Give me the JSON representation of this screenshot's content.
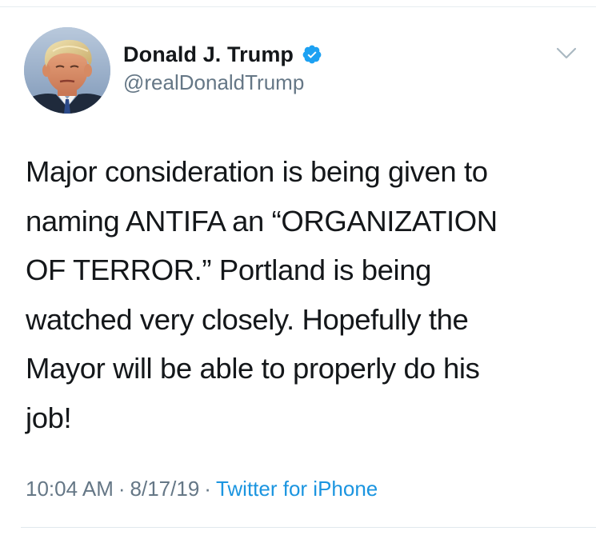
{
  "tweet": {
    "author": {
      "display_name": "Donald J. Trump",
      "handle": "@realDonaldTrump",
      "verified": true,
      "avatar_icon": "profile-photo"
    },
    "text": "Major consideration is being given to\nnaming ANTIFA an “ORGANIZATION\nOF TERROR.” Portland is being\nwatched very closely. Hopefully the\nMayor will be able to properly do his\njob!",
    "time": "10:04 AM",
    "separator": "·",
    "date": "8/17/19",
    "source": "Twitter for iPhone",
    "menu_icon": "chevron-down-icon"
  },
  "colors": {
    "text_primary": "#14171a",
    "text_secondary": "#657786",
    "link": "#1b95e0",
    "verified": "#1da1f2",
    "divider": "#e6ecf0"
  }
}
